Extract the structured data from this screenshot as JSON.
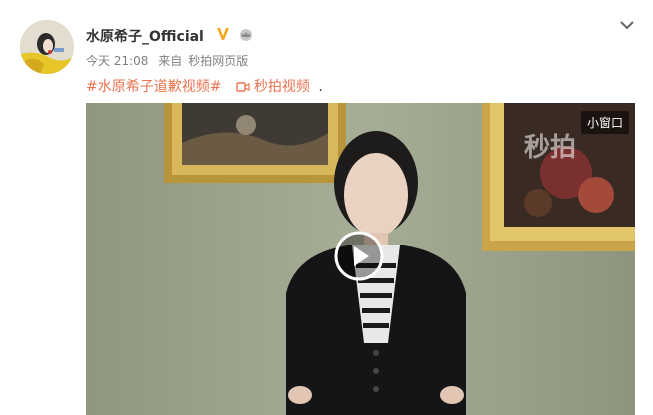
{
  "post": {
    "author": "水原希子_Official",
    "time": "今天 21:08",
    "from_label": "来自",
    "source": "秒拍网页版",
    "hashtag": "#水原希子道歉视频#",
    "video_link": "秒拍视频",
    "period": "."
  },
  "video": {
    "mini_window": "小窗口",
    "watermark": "秒拍"
  },
  "icons": {
    "verified": "verified-v-icon",
    "crown": "crown-icon",
    "dropdown": "chevron-down-icon",
    "video": "video-camera-icon",
    "play": "play-icon"
  },
  "colors": {
    "link": "#eb7350",
    "verified": "#f5a623",
    "meta": "#808080"
  }
}
